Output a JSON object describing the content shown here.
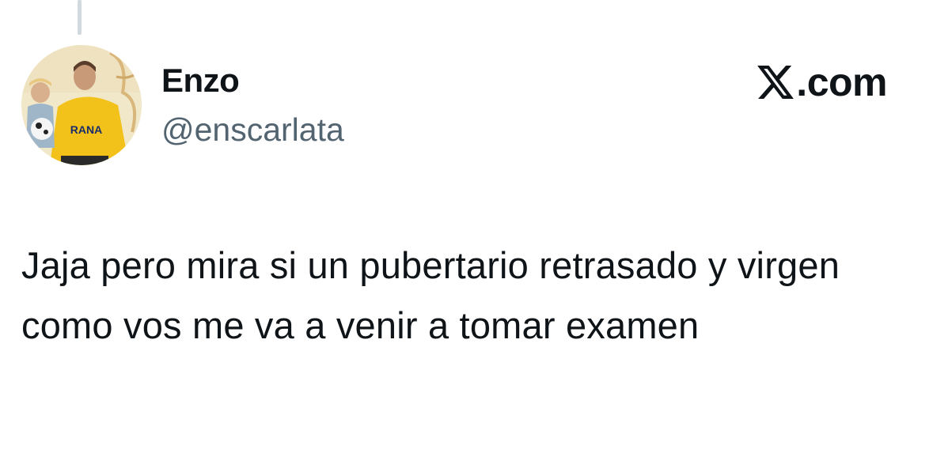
{
  "tweet": {
    "author": {
      "display_name": "Enzo",
      "handle": "@enscarlata",
      "avatar_text": "RANA"
    },
    "brand": {
      "icon": "x-logo-icon",
      "text": ".com"
    },
    "body": "Jaja pero mira si un pubertario retrasado y virgen como vos me va a venir a tomar examen"
  },
  "colors": {
    "text": "#0f1419",
    "secondary_text": "#536471",
    "thread_line": "#cfd9de",
    "avatar_jersey": "#f2c21a"
  }
}
